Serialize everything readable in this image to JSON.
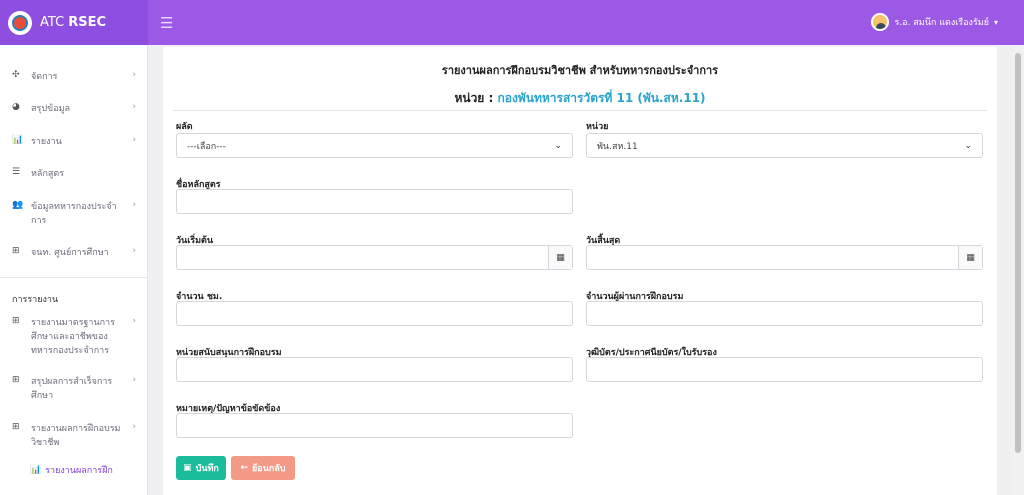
{
  "app": {
    "logo_name": "ATC",
    "logo_bold": "RSEC"
  },
  "header": {
    "user_name": "ร.อ. สมนึก แดงเรืองรัมย์",
    "user_chevron": "⌄"
  },
  "sidebar": {
    "items": [
      {
        "icon": "✣",
        "label": "จัดการ",
        "arrow": "›"
      },
      {
        "icon": "◕",
        "label": "สรุปข้อมูล",
        "arrow": "›"
      },
      {
        "icon": "📊",
        "label": "รายงาน",
        "arrow": "›"
      },
      {
        "icon": "☰",
        "label": "หลักสูตร",
        "arrow": ""
      },
      {
        "icon": "👥",
        "label": "ข้อมูลทหารกองประจำการ",
        "arrow": "›"
      },
      {
        "icon": "⊞",
        "label": "จนท. ศูนย์การศึกษา",
        "arrow": "›"
      }
    ],
    "section_title": "การรายงาน",
    "report_items": [
      {
        "icon": "⊞",
        "label": "รายงานมาตรฐานการศึกษาและอาชีพของทหารกองประจำการ",
        "arrow": "›"
      },
      {
        "icon": "⊞",
        "label": "สรุปผลการสำเร็จการศึกษา",
        "arrow": "›"
      },
      {
        "icon": "⊞",
        "label": "รายงานผลการฝึกอบรมวิชาชีพ",
        "arrow": "›"
      }
    ],
    "active_sub": {
      "icon": "📊",
      "label": "รายงานผลการฝึก"
    }
  },
  "form": {
    "title": "รายงานผลการฝึกอบรมวิชาชีพ สำหรับทหารกองประจำการ",
    "unit_prefix": "หน่วย : ",
    "unit_name": "กองพันทหารสารวัตรที่ 11 (พัน.สห.11)",
    "batch_label": "ผลัด",
    "batch_value": "---เลือก---",
    "unit_label": "หน่วย",
    "unit_value": "พัน.สห.11",
    "course_label": "ชื่อหลักสูตร",
    "start_label": "วันเริ่มต้น",
    "end_label": "วันสิ้นสุด",
    "hours_label": "จำนวน ชม.",
    "trainees_label": "จำนวนผู้ผ่านการฝึกอบรม",
    "support_label": "หน่วยสนับสนุนการฝึกอบรม",
    "certificate_label": "วุฒิบัตร/ประกาศนียบัตร/ใบรับรอง",
    "remarks_label": "หมายเหตุ/ปัญหาข้อขัดข้อง",
    "save_label": "บันทึก",
    "back_label": "ย้อนกลับ"
  },
  "colors": {
    "header": "#9b59e6",
    "accent": "#7d3fd6",
    "unit_name": "#2aa4c9",
    "save": "#1abc9c",
    "back": "#f39a86"
  }
}
